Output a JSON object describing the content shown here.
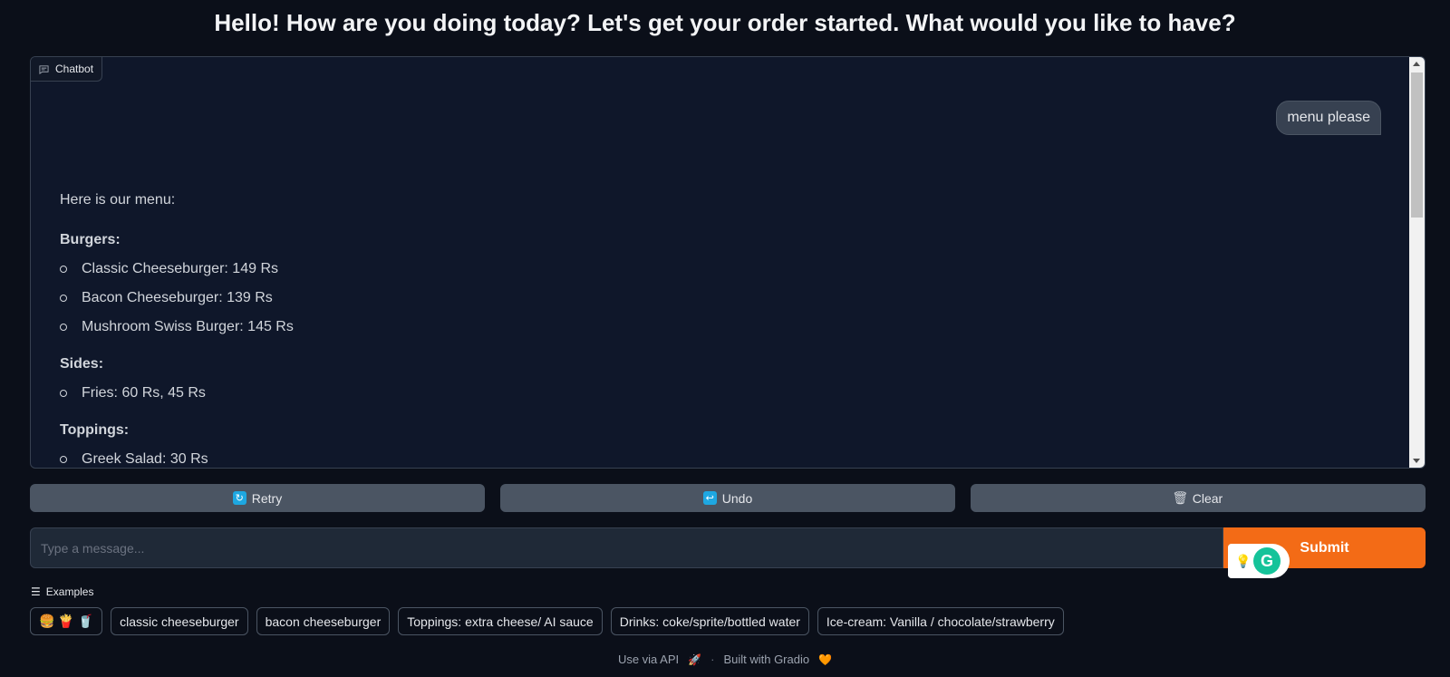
{
  "header": {
    "title": "Hello! How are you doing today? Let's get your order started. What would you like to have?"
  },
  "chatbot": {
    "label": "Chatbot",
    "user_message": "menu please",
    "bot": {
      "intro": "Here is our menu:",
      "sections": [
        {
          "title": "Burgers:",
          "items": [
            "Classic Cheeseburger: 149 Rs",
            "Bacon Cheeseburger: 139 Rs",
            "Mushroom Swiss Burger: 145 Rs"
          ]
        },
        {
          "title": "Sides:",
          "items": [
            "Fries: 60 Rs, 45 Rs"
          ]
        },
        {
          "title": "Toppings:",
          "items": [
            "Greek Salad: 30 Rs"
          ]
        }
      ]
    }
  },
  "actions": {
    "retry": "Retry",
    "undo": "Undo",
    "clear": "Clear"
  },
  "input": {
    "placeholder": "Type a message...",
    "submit": "Submit"
  },
  "examples": {
    "label": "Examples",
    "items": [
      "🍔 🍟 🥤",
      "classic cheeseburger",
      "bacon cheeseburger",
      "Toppings: extra cheese/ AI sauce",
      "Drinks: coke/sprite/bottled water",
      "Ice-cream: Vanilla / chocolate/strawberry"
    ]
  },
  "footer": {
    "api": "Use via API",
    "api_icon": "🚀",
    "separator": "·",
    "built": "Built with Gradio",
    "built_icon": "🧡"
  },
  "colors": {
    "accent": "#f36b16",
    "background": "#0b0f19",
    "panel": "#0f172a"
  }
}
